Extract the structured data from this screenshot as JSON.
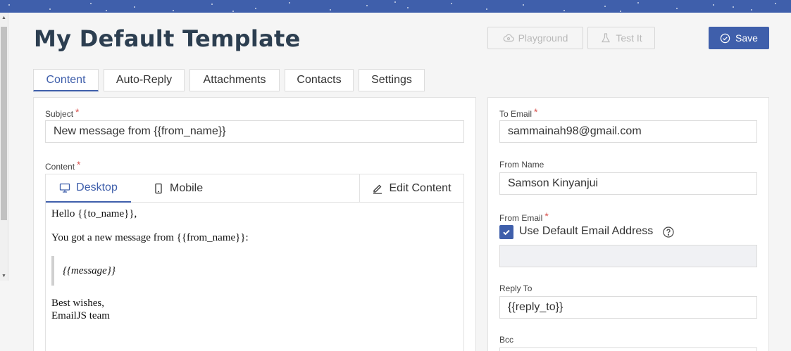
{
  "header": {
    "title": "My Default Template",
    "playground_label": "Playground",
    "test_label": "Test It",
    "save_label": "Save"
  },
  "tabs": [
    {
      "label": "Content",
      "active": true
    },
    {
      "label": "Auto-Reply",
      "active": false
    },
    {
      "label": "Attachments",
      "active": false
    },
    {
      "label": "Contacts",
      "active": false
    },
    {
      "label": "Settings",
      "active": false
    }
  ],
  "left": {
    "subject_label": "Subject",
    "subject_value": "New message from {{from_name}}",
    "content_label": "Content",
    "editor": {
      "desktop_label": "Desktop",
      "mobile_label": "Mobile",
      "edit_label": "Edit Content",
      "lines": {
        "greeting": "Hello {{to_name}},",
        "intro": "You got a new message from {{from_name}}:",
        "message": "{{message}}",
        "closing": "Best wishes,",
        "signature": "EmailJS team"
      }
    }
  },
  "right": {
    "to_email_label": "To Email",
    "to_email_value": "sammainah98@gmail.com",
    "from_name_label": "From Name",
    "from_name_value": "Samson Kinyanjui",
    "from_email_label": "From Email",
    "use_default_label": "Use Default Email Address",
    "use_default_checked": true,
    "from_email_value": "",
    "reply_to_label": "Reply To",
    "reply_to_value": "{{reply_to}}",
    "bcc_label": "Bcc"
  },
  "required_mark": "*",
  "colors": {
    "accent": "#3f5fab",
    "required": "#d9534f"
  }
}
